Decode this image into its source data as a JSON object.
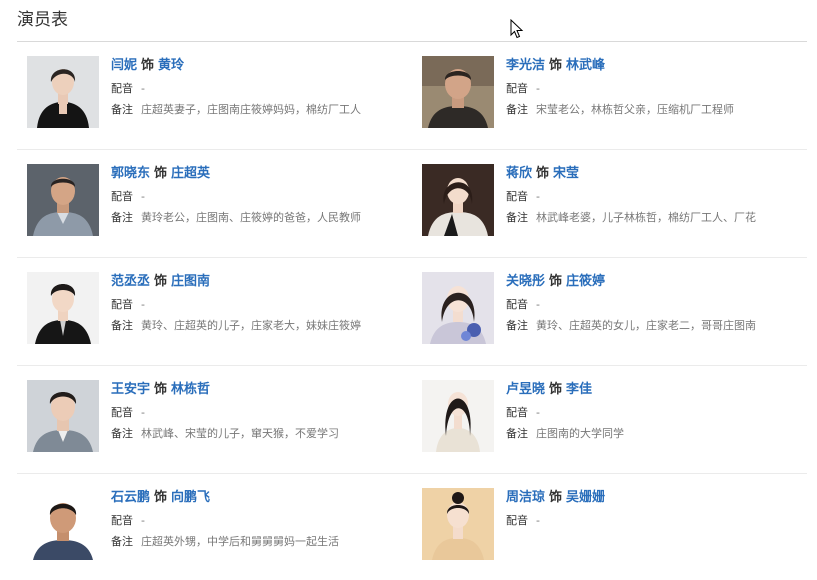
{
  "page": {
    "title": "演员表"
  },
  "labels": {
    "as": "饰",
    "dub": "配音",
    "note": "备注"
  },
  "cast": [
    {
      "actor": "闫妮",
      "role": "黄玲",
      "dub": "-",
      "note": "庄超英妻子，庄图南庄筱婷妈妈，棉纺厂工人"
    },
    {
      "actor": "李光洁",
      "role": "林武峰",
      "dub": "-",
      "note": "宋莹老公，林栋哲父亲，压缩机厂工程师"
    },
    {
      "actor": "郭晓东",
      "role": "庄超英",
      "dub": "-",
      "note": "黄玲老公，庄图南、庄筱婷的爸爸，人民教师"
    },
    {
      "actor": "蒋欣",
      "role": "宋莹",
      "dub": "-",
      "note": "林武峰老婆，儿子林栋哲，棉纺厂工人、厂花"
    },
    {
      "actor": "范丞丞",
      "role": "庄图南",
      "dub": "-",
      "note": "黄玲、庄超英的儿子，庄家老大，妹妹庄筱婷"
    },
    {
      "actor": "关晓彤",
      "role": "庄筱婷",
      "dub": "-",
      "note": "黄玲、庄超英的女儿，庄家老二，哥哥庄图南"
    },
    {
      "actor": "王安宇",
      "role": "林栋哲",
      "dub": "-",
      "note": "林武峰、宋莹的儿子，窜天猴，不爱学习"
    },
    {
      "actor": "卢昱晓",
      "role": "李佳",
      "dub": "-",
      "note": "庄图南的大学同学"
    },
    {
      "actor": "石云鹏",
      "role": "向鹏飞",
      "dub": "-",
      "note": "庄超英外甥，中学后和舅舅舅妈一起生活"
    },
    {
      "actor": "周洁琼",
      "role": "吴姗姗",
      "dub": "-",
      "note": ""
    }
  ]
}
